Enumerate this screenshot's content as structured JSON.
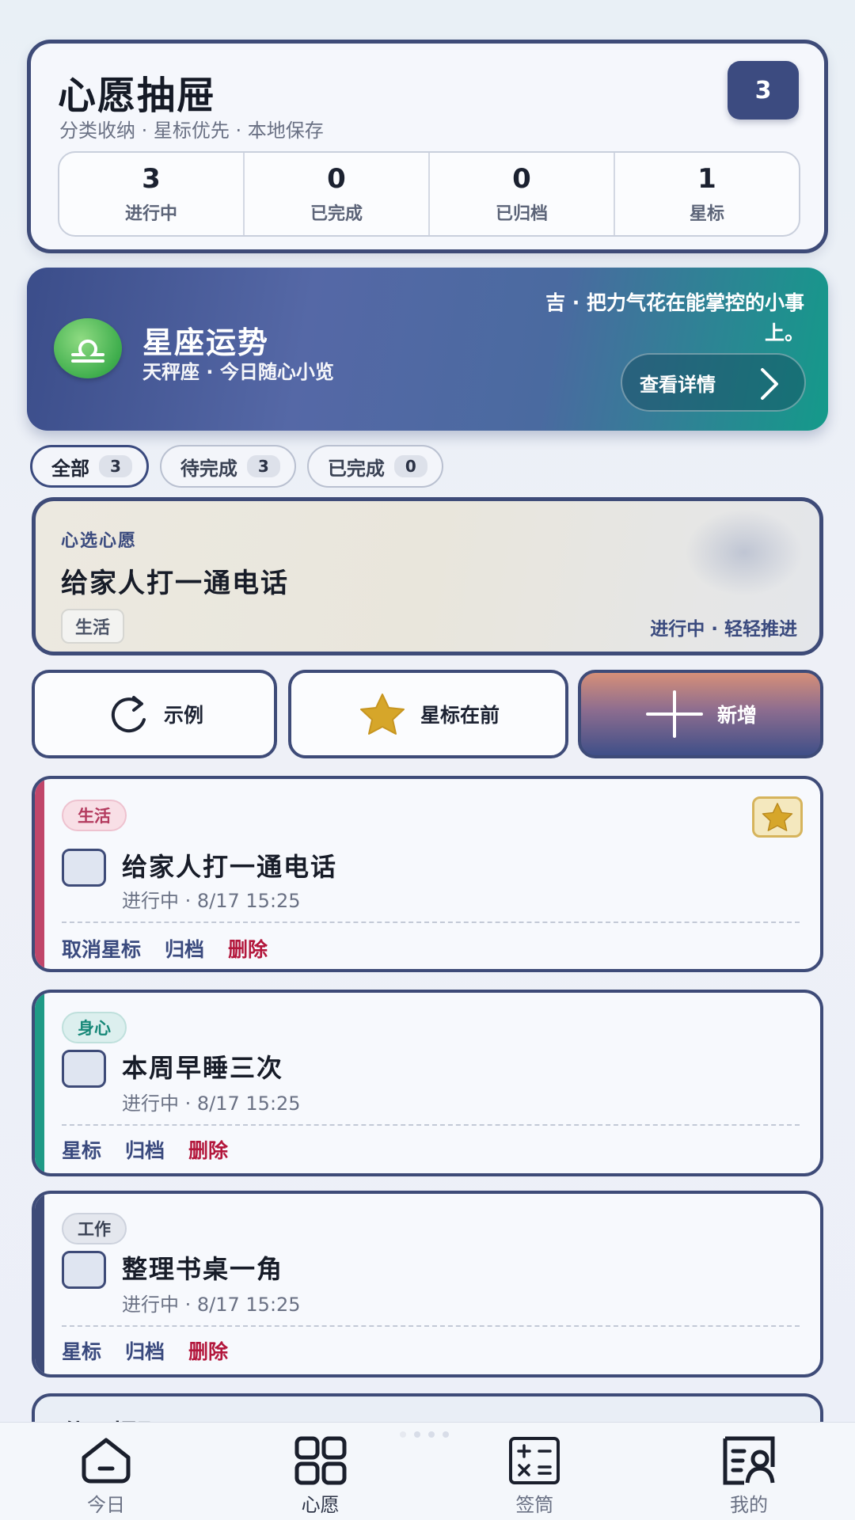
{
  "header": {
    "title": "心愿抽屉",
    "subtitle": "分类收纳 · 星标优先 · 本地保存",
    "count_badge": "3",
    "stats": [
      {
        "value": "3",
        "label": "进行中"
      },
      {
        "value": "0",
        "label": "已完成"
      },
      {
        "value": "0",
        "label": "已归档"
      },
      {
        "value": "1",
        "label": "星标"
      }
    ]
  },
  "horoscope": {
    "title": "星座运势",
    "subtitle": "天秤座 · 今日随心小览",
    "fortune": "吉 · 把力气花在能掌控的小事上。",
    "detail_button": "查看详情",
    "icon": "libra-icon"
  },
  "filters": [
    {
      "label": "全部",
      "count": "3",
      "active": true
    },
    {
      "label": "待完成",
      "count": "3",
      "active": false
    },
    {
      "label": "已完成",
      "count": "0",
      "active": false
    }
  ],
  "featured": {
    "kicker": "心选心愿",
    "title": "给家人打一通电话",
    "tag": "生活",
    "status": "进行中 · 轻轻推进"
  },
  "actions": {
    "sample": "示例",
    "star_first": "星标在前",
    "add": "新增"
  },
  "wishes": [
    {
      "tag": "生活",
      "title": "给家人打一通电话",
      "meta": "进行中 · 8/17 15:25",
      "star_op": "取消星标",
      "archive_op": "归档",
      "delete_op": "删除",
      "starred": true,
      "color": "#c0466a"
    },
    {
      "tag": "身心",
      "title": "本周早睡三次",
      "meta": "进行中 · 8/17 15:25",
      "star_op": "星标",
      "archive_op": "归档",
      "delete_op": "删除",
      "starred": false,
      "color": "#1f9a86"
    },
    {
      "tag": "工作",
      "title": "整理书桌一角",
      "meta": "进行中 · 8/17 15:25",
      "star_op": "星标",
      "archive_op": "归档",
      "delete_op": "删除",
      "starred": false,
      "color": "#3e4b78"
    }
  ],
  "partial_card": {
    "title": "使用提醒"
  },
  "nav": [
    {
      "label": "今日",
      "icon": "home-icon"
    },
    {
      "label": "心愿",
      "icon": "grid-icon"
    },
    {
      "label": "签筒",
      "icon": "calculator-icon"
    },
    {
      "label": "我的",
      "icon": "profile-icon"
    }
  ],
  "colors": {
    "accent": "#3e4b78",
    "danger": "#b3173c",
    "star": "#d6a62a"
  }
}
